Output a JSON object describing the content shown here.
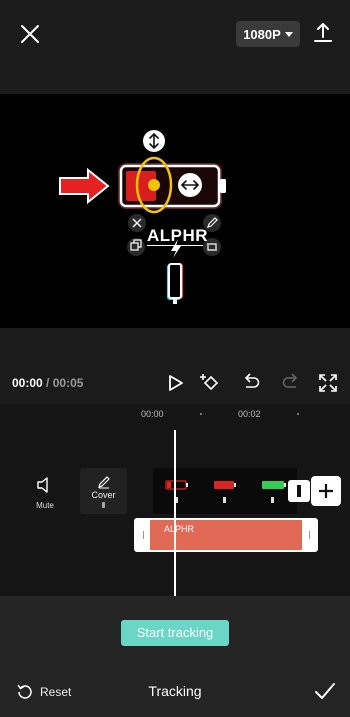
{
  "header": {
    "resolution_label": "1080P"
  },
  "preview": {
    "logo_text": "ALPHR"
  },
  "playback": {
    "current_time": "00:00",
    "separator": "/",
    "total_time": "00:05"
  },
  "timeline": {
    "ruler": [
      "00:00",
      "00:02"
    ],
    "mute_label": "Mute",
    "cover_label": "Cover",
    "overlay_clip_label": "ALPHR",
    "playhead_fraction": 0.0
  },
  "bottom": {
    "primary_button_label": "Start tracking",
    "reset_label": "Reset",
    "panel_title": "Tracking"
  },
  "colors": {
    "accent": "#6ad6c6",
    "overlay_clip": "#e06a55",
    "arrow": "#e52121",
    "highlight_ring": "#f2c500",
    "battery_green": "#33cc55",
    "battery_red": "#dd2222"
  },
  "icons": [
    "close-icon",
    "chevron-down-icon",
    "export-icon",
    "play-icon",
    "keyframe-icon",
    "undo-icon",
    "redo-icon",
    "fullscreen-icon",
    "mute-icon",
    "edit-icon",
    "split-icon",
    "plus-icon",
    "reset-icon",
    "check-icon"
  ]
}
